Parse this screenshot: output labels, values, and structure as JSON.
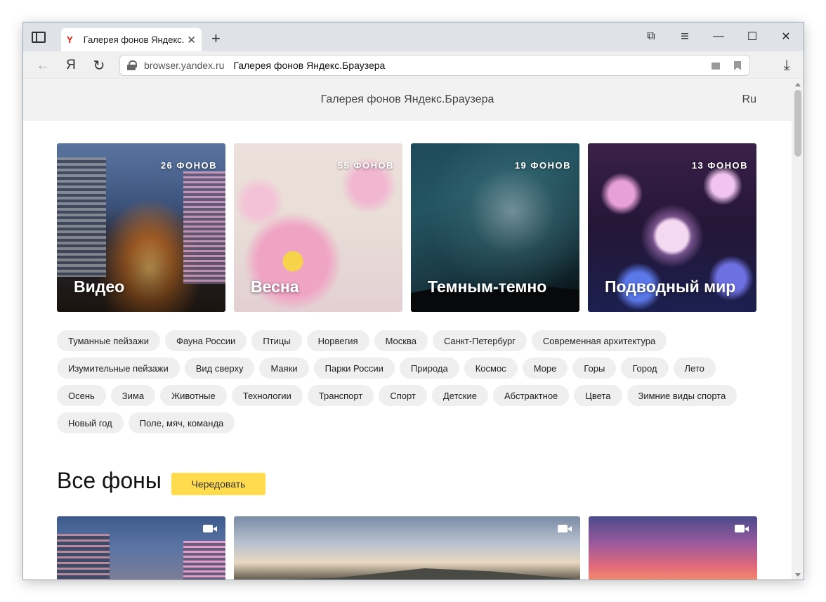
{
  "browser": {
    "tab": {
      "favicon": "Y",
      "title": "Галерея фонов Яндекс.Бра",
      "close": "✕"
    },
    "new_tab": "+",
    "window_controls": {
      "tabs_menu": "⧉",
      "menu": "≡",
      "minimize": "—",
      "maximize": "☐",
      "close": "✕"
    },
    "nav": {
      "back": "←",
      "yandex": "Я",
      "reload": "↻"
    },
    "address": {
      "domain": "browser.yandex.ru",
      "title": "Галерея фонов Яндекс.Браузера"
    },
    "download": "⤓"
  },
  "page": {
    "header": {
      "title": "Галерея фонов Яндекс.Браузера",
      "lang": "Ru"
    },
    "collections": [
      {
        "name": "Видео",
        "count": "26 ФОНОВ"
      },
      {
        "name": "Весна",
        "count": "55 ФОНОВ"
      },
      {
        "name": "Темным-темно",
        "count": "19 ФОНОВ"
      },
      {
        "name": "Подводный мир",
        "count": "13 ФОНОВ"
      }
    ],
    "tags": [
      "Туманные пейзажи",
      "Фауна России",
      "Птицы",
      "Норвегия",
      "Москва",
      "Санкт-Петербург",
      "Современная архитектура",
      "Изумительные пейзажи",
      "Вид сверху",
      "Маяки",
      "Парки России",
      "Природа",
      "Космос",
      "Море",
      "Горы",
      "Город",
      "Лето",
      "Осень",
      "Зима",
      "Животные",
      "Технологии",
      "Транспорт",
      "Спорт",
      "Детские",
      "Абстрактное",
      "Цвета",
      "Зимние виды спорта",
      "Новый год",
      "Поле, мяч, команда"
    ],
    "all": {
      "title": "Все фоны",
      "shuffle": "Чередовать"
    }
  }
}
